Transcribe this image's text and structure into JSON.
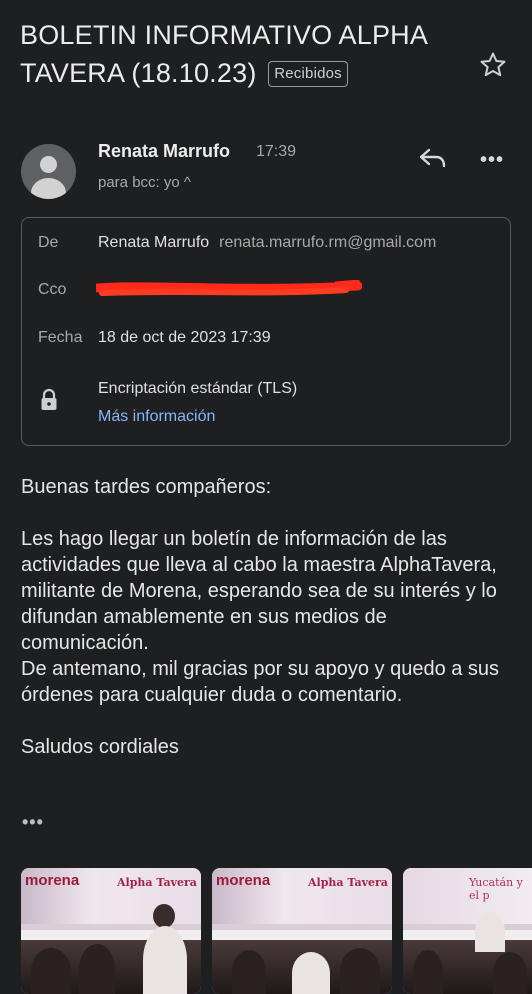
{
  "email": {
    "subject": "BOLETIN INFORMATIVO ALPHA TAVERA (18.10.23)",
    "label_badge": "Recibidos",
    "sender": {
      "name": "Renata Marrufo",
      "time": "17:39",
      "to_line": "para bcc: yo ^"
    },
    "details": {
      "from_label": "De",
      "from_name": "Renata Marrufo",
      "from_email": "renata.marrufo.rm@gmail.com",
      "cc_label": "Cco",
      "date_label": "Fecha",
      "date_value": "18 de oct de 2023 17:39",
      "encryption": "Encriptación estándar (TLS)",
      "more_info": "Más información"
    },
    "body": "Buenas tardes compañeros:\n\nLes hago llegar un boletín de información de las actividades que lleva al cabo la maestra AlphaTavera, militante de Morena, esperando sea de su interés y lo difundan amablemente en sus medios de comunicación.\nDe antemano, mil gracias por su apoyo y quedo a sus órdenes para cualquier duda o comentario.\n\nSaludos cordiales",
    "trimmed_indicator": "•••",
    "attachments": [
      {
        "logo": "morena",
        "heading": "Alpha Tavera"
      },
      {
        "logo": "morena",
        "heading": "Alpha Tavera"
      },
      {
        "logo": "",
        "heading": "Yucatán y el p"
      }
    ]
  },
  "icons": {
    "star": "star-icon",
    "reply": "reply-icon",
    "more": "more-vert-icon",
    "lock": "lock-icon",
    "avatar": "avatar-icon"
  },
  "colors": {
    "background": "#1e1f21",
    "link": "#8ab4f8",
    "redaction": "#ff2a1a",
    "morena_brand": "#9b1b37"
  }
}
